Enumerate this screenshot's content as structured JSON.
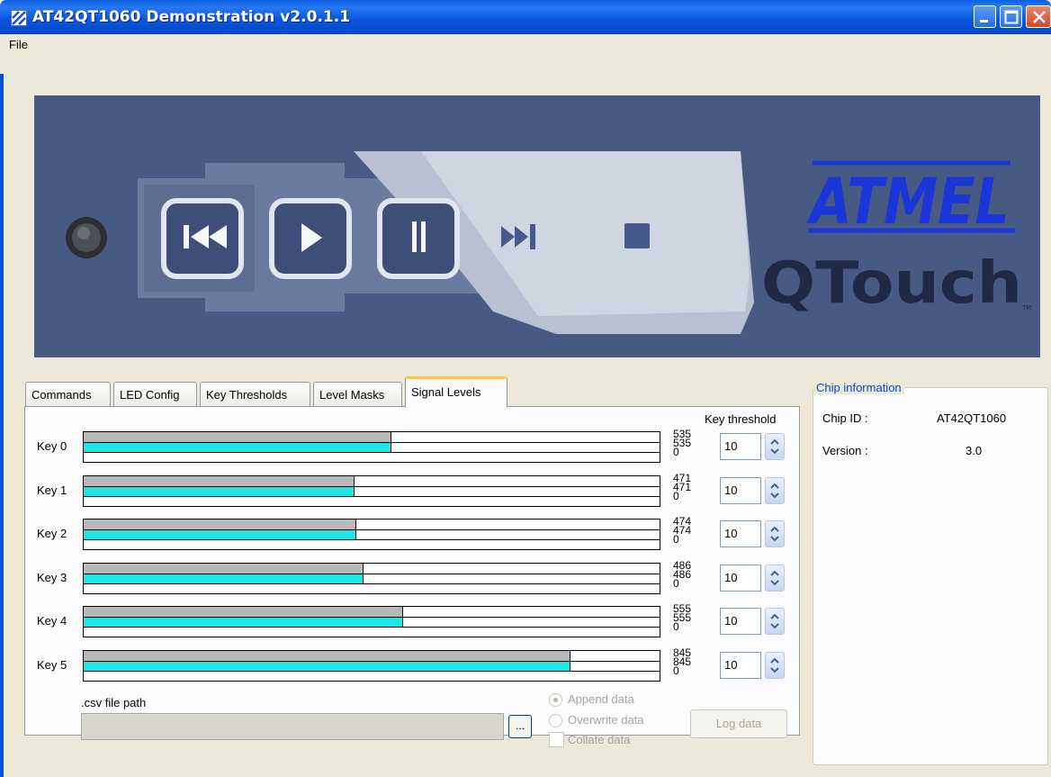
{
  "window": {
    "title": "AT42QT1060 Demonstration v2.0.1.1",
    "icon": "app-icon",
    "controls": [
      "minimize-icon",
      "maximize-icon",
      "close-icon"
    ]
  },
  "menu": {
    "file_label": "File"
  },
  "banner": {
    "brand_top": "ATMEL",
    "brand_bottom": "QTouch",
    "trademark": "TM",
    "media_icons": [
      "rewind-icon",
      "play-icon",
      "pause-icon",
      "next-icon",
      "stop-icon"
    ]
  },
  "tabs": [
    {
      "label": "Commands",
      "active": false
    },
    {
      "label": "LED Config",
      "active": false
    },
    {
      "label": "Key Thresholds",
      "active": false
    },
    {
      "label": "Level Masks",
      "active": false
    },
    {
      "label": "Signal Levels",
      "active": true
    }
  ],
  "signal_levels": {
    "threshold_header": "Key threshold",
    "bar_max": 1000,
    "keys": [
      {
        "label": "Key 0",
        "reference": "535",
        "signal": "535",
        "delta": "0",
        "threshold": "10",
        "ref_val": 535,
        "sig_val": 535
      },
      {
        "label": "Key 1",
        "reference": "471",
        "signal": "471",
        "delta": "0",
        "threshold": "10",
        "ref_val": 471,
        "sig_val": 471
      },
      {
        "label": "Key 2",
        "reference": "474",
        "signal": "474",
        "delta": "0",
        "threshold": "10",
        "ref_val": 474,
        "sig_val": 474
      },
      {
        "label": "Key 3",
        "reference": "486",
        "signal": "486",
        "delta": "0",
        "threshold": "10",
        "ref_val": 486,
        "sig_val": 486
      },
      {
        "label": "Key 4",
        "reference": "555",
        "signal": "555",
        "delta": "0",
        "threshold": "10",
        "ref_val": 555,
        "sig_val": 555
      },
      {
        "label": "Key 5",
        "reference": "845",
        "signal": "845",
        "delta": "0",
        "threshold": "10",
        "ref_val": 845,
        "sig_val": 845
      }
    ]
  },
  "logging": {
    "csv_label": ".csv file path",
    "csv_value": "",
    "browse_label": "...",
    "append_label": "Append data",
    "overwrite_label": "Overwrite data",
    "collate_label": "Collate data",
    "log_button": "Log data"
  },
  "chip_info": {
    "legend": "Chip information",
    "chip_id_label": "Chip ID :",
    "chip_id_value": "AT42QT1060",
    "version_label": "Version :",
    "version_value": "3.0"
  },
  "colors": {
    "banner_bg": "#465a83",
    "signal_bar": "#1ee6e6",
    "reference_bar": "#b9b9b9",
    "atmel_blue": "#1a36d6"
  }
}
